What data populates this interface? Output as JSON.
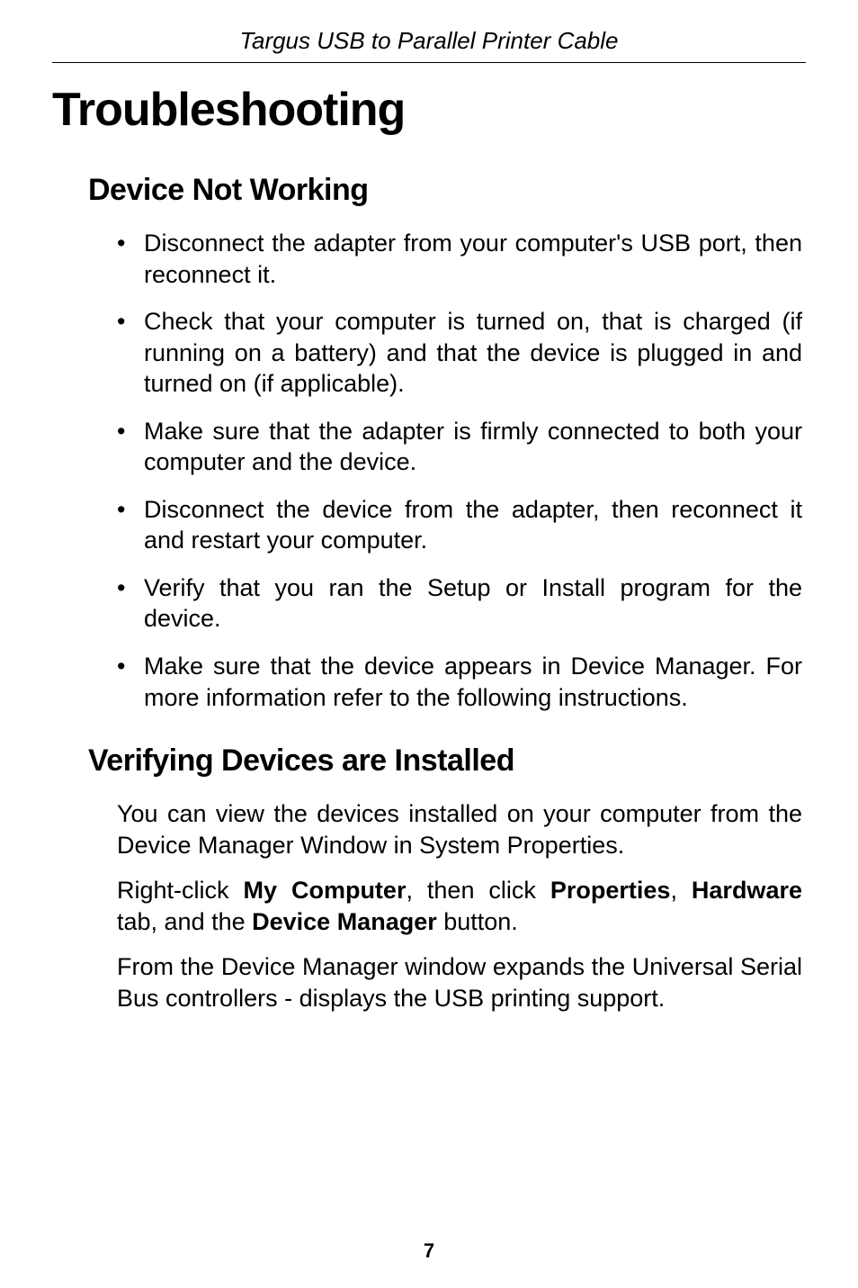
{
  "header": {
    "product_title": "Targus USB to Parallel Printer Cable"
  },
  "main": {
    "title": "Troubleshooting",
    "sections": [
      {
        "heading": "Device Not Working",
        "bullets": [
          "Disconnect the adapter from your computer's USB port, then reconnect it.",
          "Check that your computer is turned on, that is charged (if running on a battery) and that the device is plugged in and turned on (if applicable).",
          "Make sure that the adapter is firmly connected to both your computer and the device.",
          "Disconnect the device from the adapter, then reconnect it and restart your computer.",
          "Verify that you ran the Setup or Install program for the device.",
          "Make sure that the device appears in Device Manager. For more information refer to the following instructions."
        ]
      },
      {
        "heading": "Verifying Devices are Installed",
        "paragraphs": {
          "p1": "You can view the devices installed on your computer from the Device Manager Window in System Properties.",
          "p2_pre": "Right-click ",
          "p2_b1": "My Computer",
          "p2_mid1": ", then click ",
          "p2_b2": "Properties",
          "p2_mid2": ", ",
          "p2_b3": "Hardware",
          "p2_mid3": " tab, and the ",
          "p2_b4": "Device Manager",
          "p2_post": " button.",
          "p3": "From the Device Manager window expands the Universal Serial Bus controllers - displays the USB printing support."
        }
      }
    ]
  },
  "page_number": "7"
}
